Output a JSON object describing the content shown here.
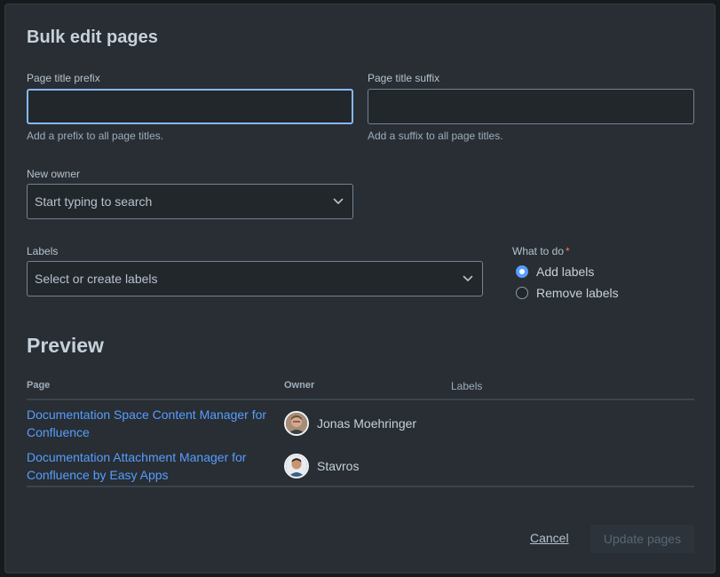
{
  "modal": {
    "title": "Bulk edit pages"
  },
  "prefix": {
    "label": "Page title prefix",
    "value": "",
    "helper": "Add a prefix to all page titles."
  },
  "suffix": {
    "label": "Page title suffix",
    "value": "",
    "helper": "Add a suffix to all page titles."
  },
  "owner_field": {
    "label": "New owner",
    "placeholder": "Start typing to search"
  },
  "labels_field": {
    "label": "Labels",
    "placeholder": "Select or create labels"
  },
  "action": {
    "label": "What to do",
    "required_mark": "*",
    "options": [
      {
        "label": "Add labels",
        "selected": true
      },
      {
        "label": "Remove labels",
        "selected": false
      }
    ]
  },
  "preview": {
    "title": "Preview",
    "columns": [
      "Page",
      "Owner",
      "Labels"
    ],
    "rows": [
      {
        "page": "Documentation Space Content Manager for Confluence",
        "owner": "Jonas Moehringer",
        "avatar_icon": "person-avatar-icon",
        "labels": ""
      },
      {
        "page": "Documentation Attachment Manager for Confluence by Easy Apps",
        "owner": "Stavros",
        "avatar_icon": "person-avatar-icon",
        "labels": ""
      }
    ]
  },
  "footer": {
    "cancel_label": "Cancel",
    "update_label": "Update pages"
  },
  "colors": {
    "modal_bg": "#282e33",
    "link": "#579dff",
    "focus": "#85b8ff",
    "radio_selected": "#579dff",
    "required": "#f87168"
  }
}
